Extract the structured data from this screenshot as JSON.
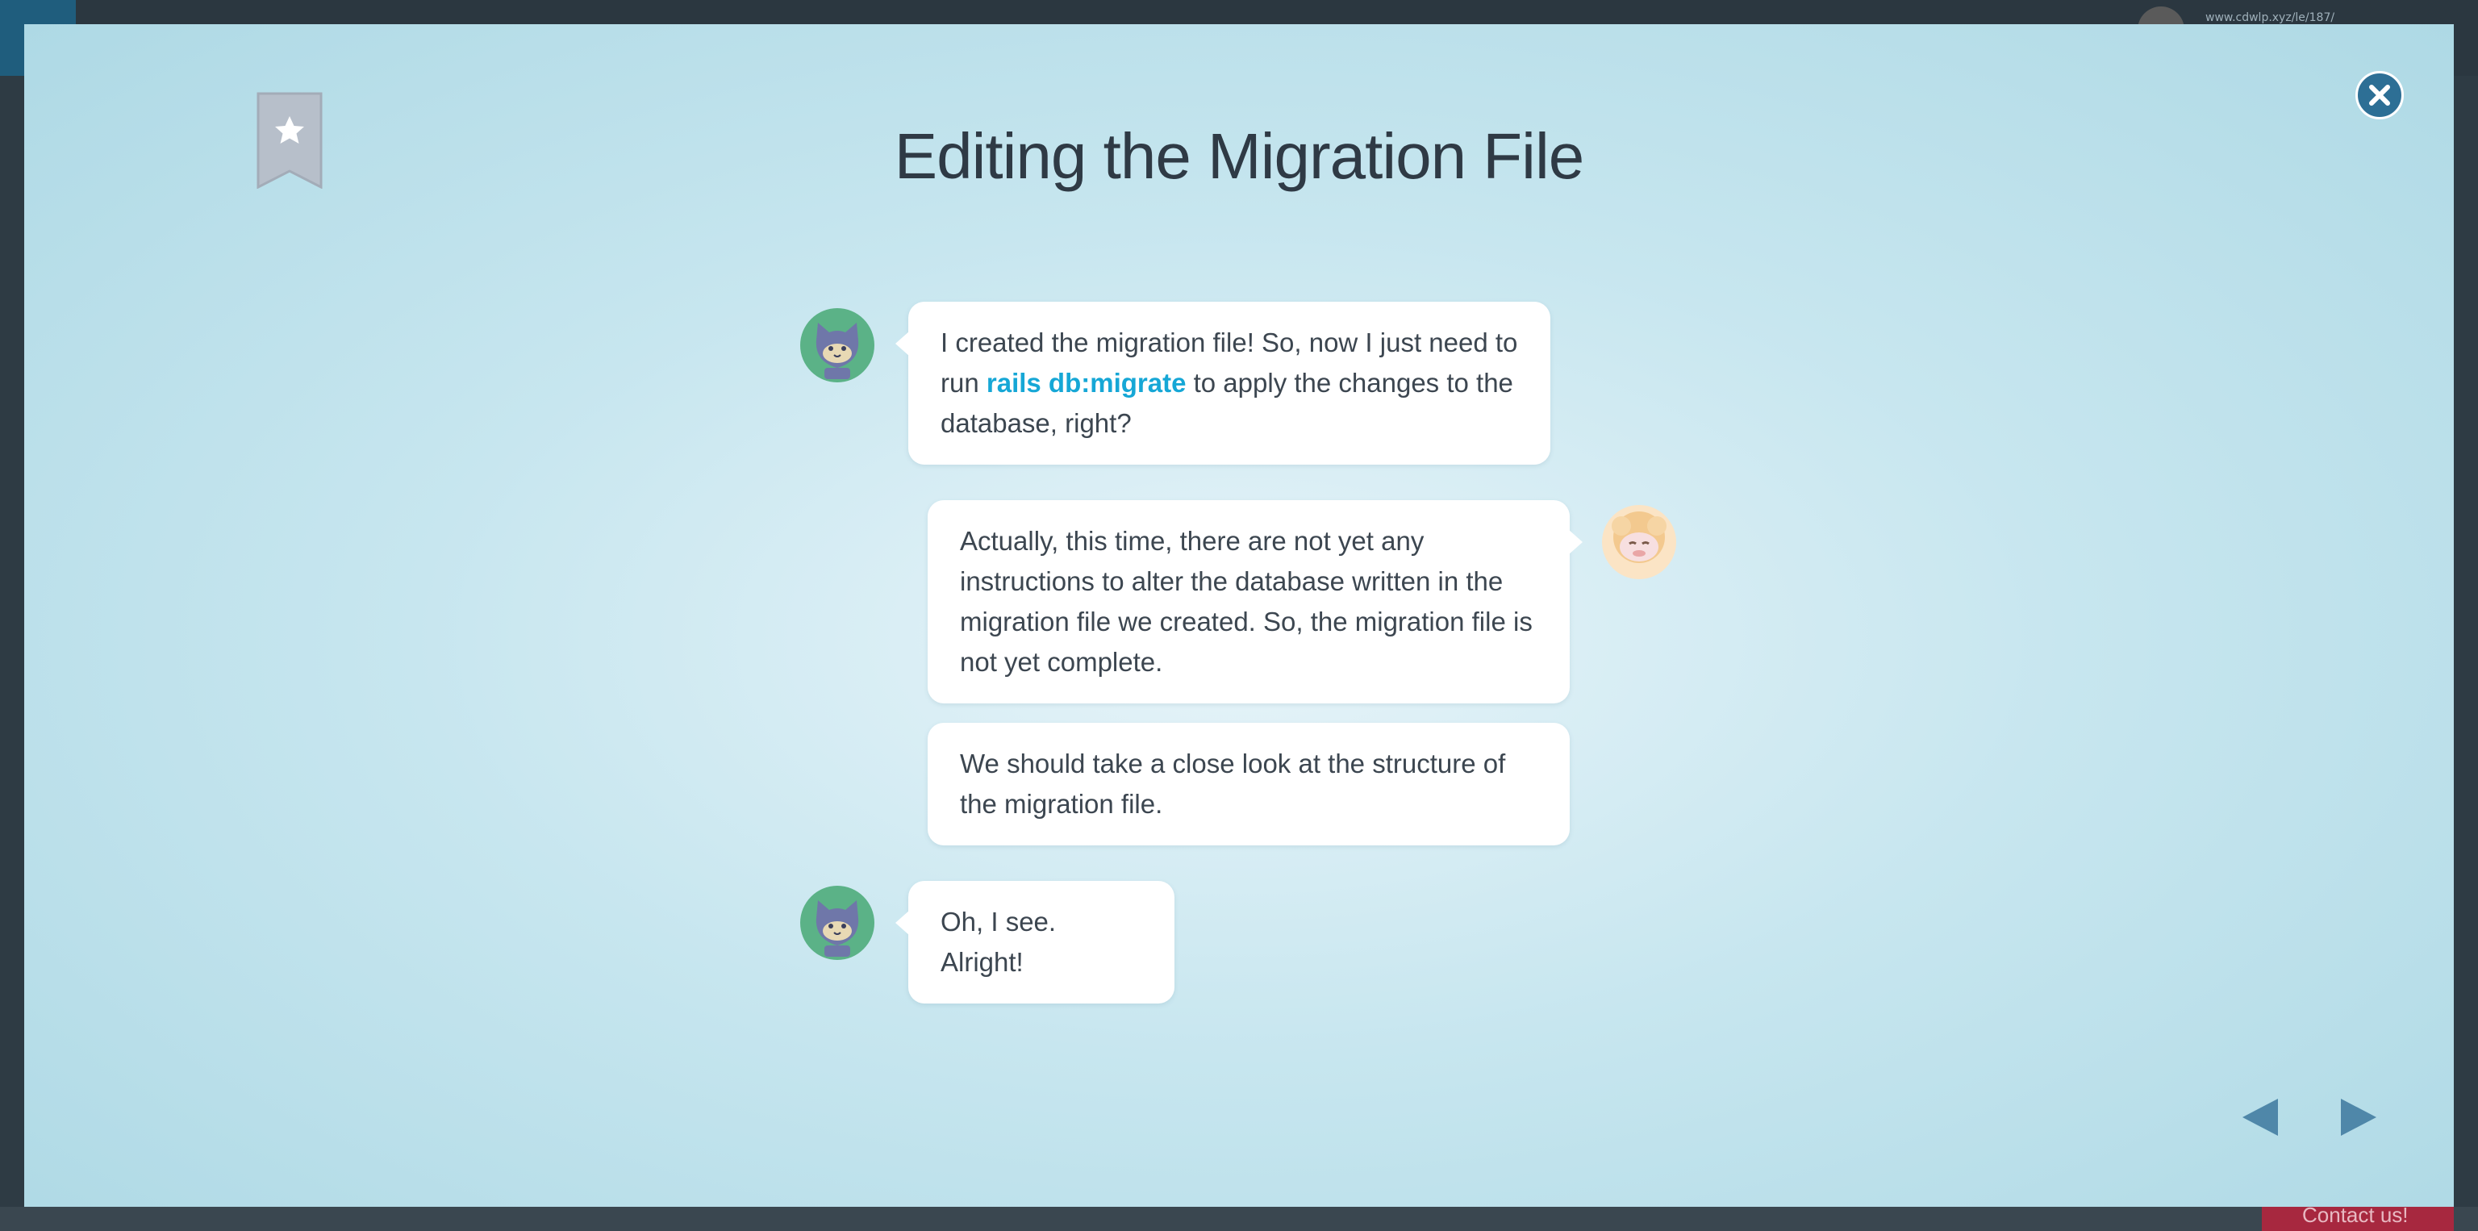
{
  "background": {
    "url_text": "www.cdwlp.xyz/le/187/",
    "contact_label": "Contact us!"
  },
  "modal": {
    "title": "Editing the Migration File"
  },
  "messages": [
    {
      "speaker": "cat",
      "side": "left",
      "before": "I created the migration file! So, now I just need to run ",
      "code": "rails db:migrate",
      "after": " to apply the changes to the database, right?"
    },
    {
      "speaker": "sheep",
      "side": "right",
      "text": "Actually, this time, there are not yet any instructions to alter the database written in the migration file we created. So, the migration file is not yet complete."
    },
    {
      "speaker": "sheep",
      "side": "right",
      "text": "We should take a close look at the structure of the migration file."
    },
    {
      "speaker": "cat",
      "side": "left",
      "text": "Oh, I see. Alright!"
    }
  ],
  "icons": {
    "bookmark": "bookmark-star-icon",
    "close": "close-icon",
    "prev": "prev-arrow-icon",
    "next": "next-arrow-icon"
  },
  "colors": {
    "accent_code": "#16a7d6",
    "close_button": "#2d6f95",
    "nav_arrow": "#4f87a9",
    "bookmark": "#b7bfca"
  }
}
